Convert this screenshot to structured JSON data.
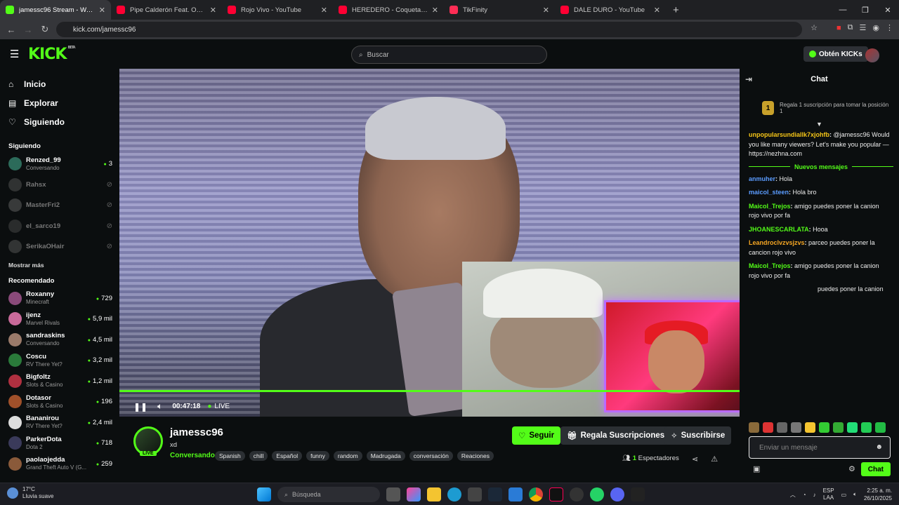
{
  "browser": {
    "tabs": [
      {
        "title": "jamessc96 Stream - Watch Live",
        "color": "#53fc18",
        "active": true
      },
      {
        "title": "Pipe Calderón Feat. Oco Yajé - Luz Verde",
        "color": "#ff0033",
        "active": false
      },
      {
        "title": "Rojo Vivo - YouTube",
        "color": "#ff0033",
        "active": false
      },
      {
        "title": "HEREDERO - Coqueta (Audio Oficial)",
        "color": "#ff0033",
        "active": false
      },
      {
        "title": "TikFinity",
        "color": "#ff2d55",
        "active": false
      },
      {
        "title": "DALE DURO - YouTube",
        "color": "#ff0033",
        "active": false
      }
    ],
    "url": "kick.com/jamessc96"
  },
  "header": {
    "logo": "KICK",
    "beta": "BETA",
    "search_placeholder": "Buscar",
    "kicks_button": "Obtén KICKs"
  },
  "sidebar": {
    "nav": [
      {
        "label": "Inicio",
        "icon": "home-icon",
        "glyph": "⌂"
      },
      {
        "label": "Explorar",
        "icon": "browse-icon",
        "glyph": "▤"
      },
      {
        "label": "Siguiendo",
        "icon": "heart-icon",
        "glyph": "♡"
      }
    ],
    "following_heading": "Siguiendo",
    "following": [
      {
        "name": "Renzed_99",
        "sub": "Conversando",
        "viewers": "3",
        "online": true,
        "color": "#2c6b5a"
      },
      {
        "name": "Rahsx",
        "sub": "",
        "viewers": "",
        "online": false,
        "color": "#555"
      },
      {
        "name": "MasterFri2",
        "sub": "",
        "viewers": "",
        "online": false,
        "color": "#666"
      },
      {
        "name": "el_sarco19",
        "sub": "",
        "viewers": "",
        "online": false,
        "color": "#4a4a4a"
      },
      {
        "name": "SerikaOHair",
        "sub": "",
        "viewers": "",
        "online": false,
        "color": "#5a5a5a"
      }
    ],
    "show_more": "Mostrar más",
    "recommended_heading": "Recomendado",
    "recommended": [
      {
        "name": "Roxanny",
        "sub": "Minecraft",
        "viewers": "729",
        "color": "#8a4a7a"
      },
      {
        "name": "ijenz",
        "sub": "Marvel Rivals",
        "viewers": "5,9 mil",
        "color": "#c96a9a"
      },
      {
        "name": "sandraskins",
        "sub": "Conversando",
        "viewers": "4,5 mil",
        "color": "#9a7a6a"
      },
      {
        "name": "Coscu",
        "sub": "RV There Yet?",
        "viewers": "3,2 mil",
        "color": "#2a7a3a"
      },
      {
        "name": "Bigfoltz",
        "sub": "Slots & Casino",
        "viewers": "1,2 mil",
        "color": "#b03040"
      },
      {
        "name": "Dotasor",
        "sub": "Slots & Casino",
        "viewers": "196",
        "color": "#a0502a"
      },
      {
        "name": "Bananirou",
        "sub": "RV There Yet?",
        "viewers": "2,4 mil",
        "color": "#dddddd"
      },
      {
        "name": "ParkerDota",
        "sub": "Dota 2",
        "viewers": "718",
        "color": "#3a3a5a"
      },
      {
        "name": "paolaojedda",
        "sub": "Grand Theft Auto V (G...",
        "viewers": "259",
        "color": "#8a5a3a"
      }
    ]
  },
  "player": {
    "time": "00:47:18",
    "live_label": "LIVE"
  },
  "stream": {
    "streamer": "jamessc96",
    "title": "xd",
    "category": "Conversando",
    "live_badge": "LIVE",
    "tags": [
      "Spanish",
      "chill",
      "Español",
      "funny",
      "random",
      "Madrugada",
      "conversación",
      "Reaciones"
    ],
    "follow_label": "Seguir",
    "gift_label": "Regala Suscripciones",
    "subscribe_label": "Suscribirse",
    "viewer_count": "1",
    "viewer_label": "Espectadores"
  },
  "chat": {
    "title": "Chat",
    "pinned_rank": "1",
    "pinned_text": "Regala 1 suscripción para tomar la posición 1",
    "new_messages": "Nuevos mensajes",
    "first_message": {
      "user": "unpopularsundiallk7xjohfb",
      "color": "#f5c518",
      "text": " @jamessc96 Would you like many viewers? Let's make you popular — https://nezhna.com"
    },
    "messages": [
      {
        "user": "anmuher",
        "color": "#5b9cff",
        "text": " Hola"
      },
      {
        "user": "maicol_steen",
        "color": "#5b9cff",
        "text": " Hola bro"
      },
      {
        "user": "Maicol_Trejos",
        "color": "#53fc18",
        "text": " amigo puedes poner la canion rojo vivo por fa"
      },
      {
        "user": "JHOANESCARLATA",
        "color": "#53fc18",
        "text": " Hooa"
      },
      {
        "user": "Leandroclvzvsjzvs",
        "color": "#f5a623",
        "text": " parceo puedes poner la cancion rojo vivo"
      },
      {
        "user": "Maicol_Trejos",
        "color": "#53fc18",
        "text": " amigo puedes poner la canion rojo vivo por fa"
      },
      {
        "user": "",
        "color": "#53fc18",
        "text": "puedes poner la canion"
      }
    ],
    "input_placeholder": "Enviar un mensaje",
    "send_label": "Chat"
  },
  "taskbar": {
    "temp": "17°C",
    "weather": "Lluvia suave",
    "search_placeholder": "Búsqueda",
    "lang": "ESP",
    "lang2": "LAA",
    "time": "2:25 a. m.",
    "date": "26/10/2025"
  }
}
